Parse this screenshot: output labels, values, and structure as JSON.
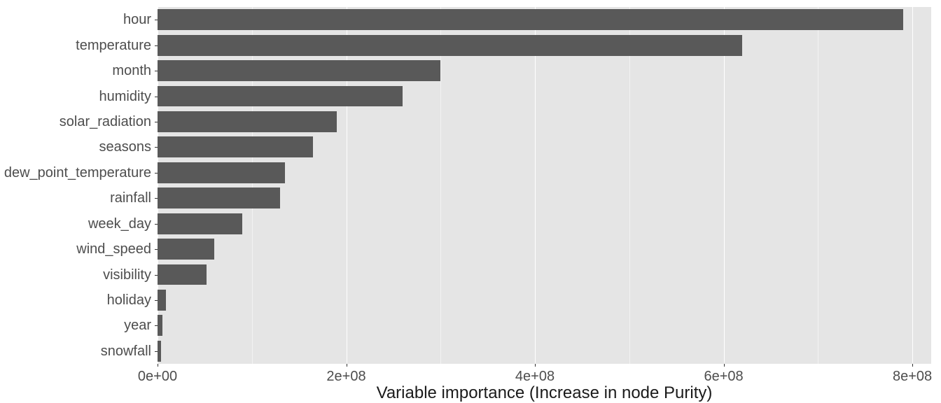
{
  "chart_data": {
    "type": "bar",
    "orientation": "horizontal",
    "xlabel": "Variable importance (Increase in node Purity)",
    "ylabel": "",
    "xlim": [
      0,
      820000000
    ],
    "x_ticks": [
      {
        "value": 0,
        "label": "0e+00"
      },
      {
        "value": 200000000,
        "label": "2e+08"
      },
      {
        "value": 400000000,
        "label": "4e+08"
      },
      {
        "value": 600000000,
        "label": "6e+08"
      },
      {
        "value": 800000000,
        "label": "8e+08"
      }
    ],
    "categories": [
      "hour",
      "temperature",
      "month",
      "humidity",
      "solar_radiation",
      "seasons",
      "dew_point_temperature",
      "rainfall",
      "week_day",
      "wind_speed",
      "visibility",
      "holiday",
      "year",
      "snowfall"
    ],
    "values": [
      790000000,
      620000000,
      300000000,
      260000000,
      190000000,
      165000000,
      135000000,
      130000000,
      90000000,
      60000000,
      52000000,
      9000000,
      5000000,
      4000000
    ],
    "bar_color": "#595959",
    "panel_bg": "#e5e5e5"
  }
}
